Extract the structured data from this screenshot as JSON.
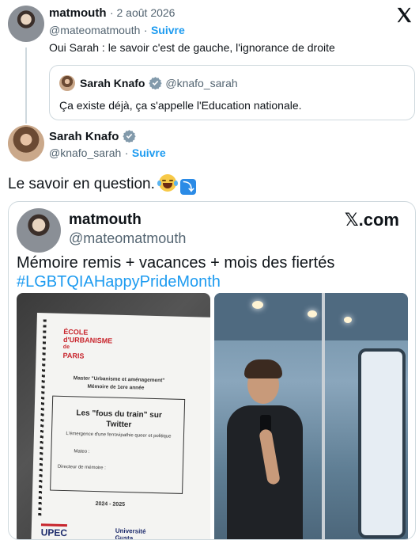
{
  "reply": {
    "author_name": "matmouth",
    "date": "· 2 août 2026",
    "handle": "@mateomatmouth",
    "separator": "·",
    "follow_label": "Suivre",
    "text": "Oui Sarah : le savoir c'est de gauche, l'ignorance de droite"
  },
  "quoted": {
    "author_name": "Sarah Knafo",
    "handle": "@knafo_sarah",
    "text": "Ça existe déjà, ça s'appelle l'Education nationale."
  },
  "main": {
    "author_name": "Sarah Knafo",
    "handle": "@knafo_sarah",
    "separator": "·",
    "follow_label": "Suivre",
    "text": "Le savoir en question.",
    "emoji": [
      "face-with-tears-of-joy",
      "arrow-curving-down"
    ]
  },
  "embedded": {
    "author_name": "matmouth",
    "handle": "@mateomatmouth",
    "brand": "𝕏.com",
    "text": "Mémoire remis + vacances + mois des fiertés",
    "hashtag": "#LGBTQIAHappyPrideMonth",
    "memoir": {
      "school": [
        "ÉCOLE",
        "d'URBANISME",
        "de",
        "PARIS"
      ],
      "master": "Master \"Urbanisme et aménagement\"",
      "year_label": "Mémoire de 1ere année",
      "title": "Les \"fous du train\" sur Twitter",
      "subtitle": "L'émergence d'une ferrovipathie queer et politique",
      "author_label": "Mateo :",
      "director_label": "Directeur de mémoire :",
      "period": "2024 - 2025",
      "logo_left": "UPEC",
      "logo_right": "Université Gusta"
    }
  },
  "icons": {
    "x_logo": "x-logo-icon",
    "verified": "verified-badge-icon"
  },
  "colors": {
    "accent": "#1d9bf0",
    "text": "#0f1419",
    "muted": "#536471",
    "border": "#cfd9de",
    "hashtag": "#1d9bf0",
    "school_red": "#c8252d"
  }
}
